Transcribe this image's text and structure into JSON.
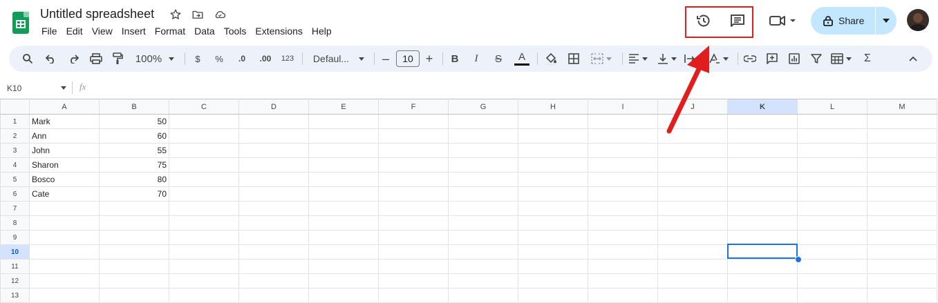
{
  "doc": {
    "title": "Untitled spreadsheet"
  },
  "menu": [
    "File",
    "Edit",
    "View",
    "Insert",
    "Format",
    "Data",
    "Tools",
    "Extensions",
    "Help"
  ],
  "share": {
    "label": "Share"
  },
  "toolbar": {
    "zoom": "100%",
    "currency": "$",
    "percent": "%",
    "dec_decrease": ".0",
    "dec_increase": ".00",
    "format_123": "123",
    "font": "Defaul...",
    "font_size": "10",
    "minus": "–",
    "plus": "+",
    "bold": "B",
    "italic": "I",
    "strike": "S",
    "text_color": "A",
    "sum": "Σ"
  },
  "formula_bar": {
    "name_box": "K10",
    "fx": "fx"
  },
  "grid": {
    "columns": [
      "A",
      "B",
      "C",
      "D",
      "E",
      "F",
      "G",
      "H",
      "I",
      "J",
      "K",
      "L",
      "M"
    ],
    "rows": [
      {
        "n": "1",
        "a": "Mark",
        "b": "50"
      },
      {
        "n": "2",
        "a": "Ann",
        "b": "60"
      },
      {
        "n": "3",
        "a": "John",
        "b": "55"
      },
      {
        "n": "4",
        "a": "Sharon",
        "b": "75"
      },
      {
        "n": "5",
        "a": "Bosco",
        "b": "80"
      },
      {
        "n": "6",
        "a": "Cate",
        "b": "70"
      },
      {
        "n": "7",
        "a": "",
        "b": ""
      },
      {
        "n": "8",
        "a": "",
        "b": ""
      },
      {
        "n": "9",
        "a": "",
        "b": ""
      },
      {
        "n": "10",
        "a": "",
        "b": ""
      },
      {
        "n": "11",
        "a": "",
        "b": ""
      },
      {
        "n": "12",
        "a": "",
        "b": ""
      },
      {
        "n": "13",
        "a": "",
        "b": ""
      }
    ],
    "selected_column": "K",
    "selected_row": "10"
  },
  "colors": {
    "accent": "#1a73e8",
    "annotation": "#e21d1d",
    "share_bg": "#c2e7ff",
    "toolbar_bg": "#edf2fa"
  }
}
